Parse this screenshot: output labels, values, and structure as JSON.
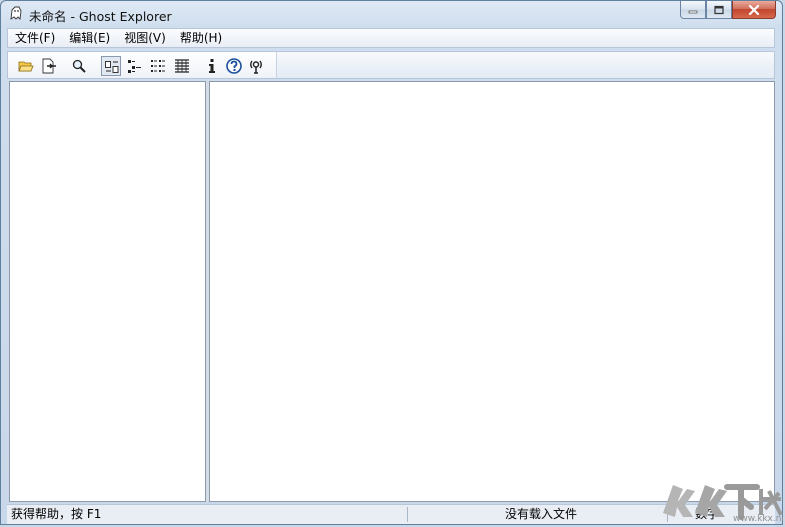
{
  "window": {
    "title": "未命名 - Ghost Explorer"
  },
  "menu": [
    {
      "label": "文件(F)"
    },
    {
      "label": "编辑(E)"
    },
    {
      "label": "视图(V)"
    },
    {
      "label": "帮助(H)"
    }
  ],
  "toolbar": {
    "buttons": [
      {
        "icon": "folder-open-icon"
      },
      {
        "icon": "extract-icon"
      },
      {
        "icon": "search-icon"
      },
      {
        "icon": "large-icons-view-icon"
      },
      {
        "icon": "small-icons-view-icon"
      },
      {
        "icon": "list-view-icon"
      },
      {
        "icon": "details-view-icon"
      },
      {
        "icon": "info-icon"
      },
      {
        "icon": "help-icon"
      },
      {
        "icon": "antenna-icon"
      }
    ]
  },
  "statusbar": {
    "help_text": "获得帮助，按 F1",
    "file_status": "没有载入文件",
    "num_lock": "数字"
  },
  "watermark": {
    "text": "KK下载",
    "url": "www.kkx.net"
  },
  "colors": {
    "accent_blue": "#1b4f9c",
    "watermark_gray": "#a6a6a6"
  }
}
